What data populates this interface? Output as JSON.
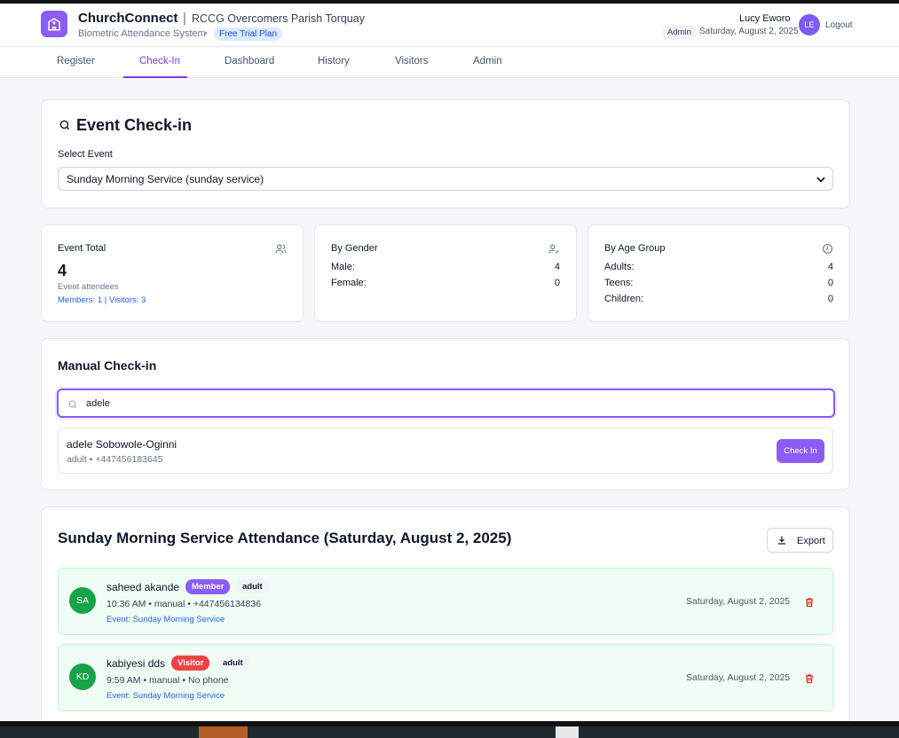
{
  "header": {
    "brand": "ChurchConnect",
    "separator": "|",
    "parish": "RCCG Overcomers Parish Torquay",
    "subtitle": "Biometric Attendance System",
    "dot": "•",
    "plan": "Free Trial Plan",
    "user_name": "Lucy Eworo",
    "role": "Admin",
    "date": "Saturday, August 2, 2025",
    "avatar_initials": "LE",
    "logout": "Logout"
  },
  "nav": {
    "tabs": [
      {
        "label": "Register"
      },
      {
        "label": "Check-In"
      },
      {
        "label": "Dashboard"
      },
      {
        "label": "History"
      },
      {
        "label": "Visitors"
      },
      {
        "label": "Admin"
      }
    ],
    "active": "Check-In"
  },
  "event_checkin": {
    "title": "Event Check-in",
    "select_label": "Select Event",
    "selected_event": "Sunday Morning Service (sunday service)"
  },
  "stats": {
    "event_total": {
      "title": "Event Total",
      "value": "4",
      "caption": "Event attendees",
      "breakdown": "Members: 1 | Visitors: 3"
    },
    "by_gender": {
      "title": "By Gender",
      "rows": [
        {
          "label": "Male:",
          "value": "4"
        },
        {
          "label": "Female:",
          "value": "0"
        }
      ]
    },
    "by_age": {
      "title": "By Age Group",
      "rows": [
        {
          "label": "Adults:",
          "value": "4"
        },
        {
          "label": "Teens:",
          "value": "0"
        },
        {
          "label": "Children:",
          "value": "0"
        }
      ]
    }
  },
  "manual_checkin": {
    "title": "Manual Check-in",
    "search_value": "adele",
    "result": {
      "name": "adele Sobowole-Oginni",
      "detail": "adult • +447456183645",
      "button": "Check In"
    }
  },
  "attendance": {
    "title": "Sunday Morning Service Attendance (Saturday, August 2, 2025)",
    "export_label": "Export",
    "records": [
      {
        "initials": "SA",
        "name": "saheed akande",
        "type": "Member",
        "age": "adult",
        "meta": "10:36 AM • manual • +447456134836",
        "event": "Event: Sunday Morning Service",
        "date": "Saturday, August 2, 2025"
      },
      {
        "initials": "KD",
        "name": "kabiyesi dds",
        "type": "Visitor",
        "age": "adult",
        "meta": "9:59 AM • manual • No phone",
        "event": "Event: Sunday Morning Service",
        "date": "Saturday, August 2, 2025"
      }
    ]
  },
  "colors": {
    "accent": "#8b5cf6",
    "member_badge": "#8b5cf6",
    "visitor_badge": "#ef4444",
    "record_bg": "#f0fdf4",
    "avatar_green": "#16a34a"
  }
}
